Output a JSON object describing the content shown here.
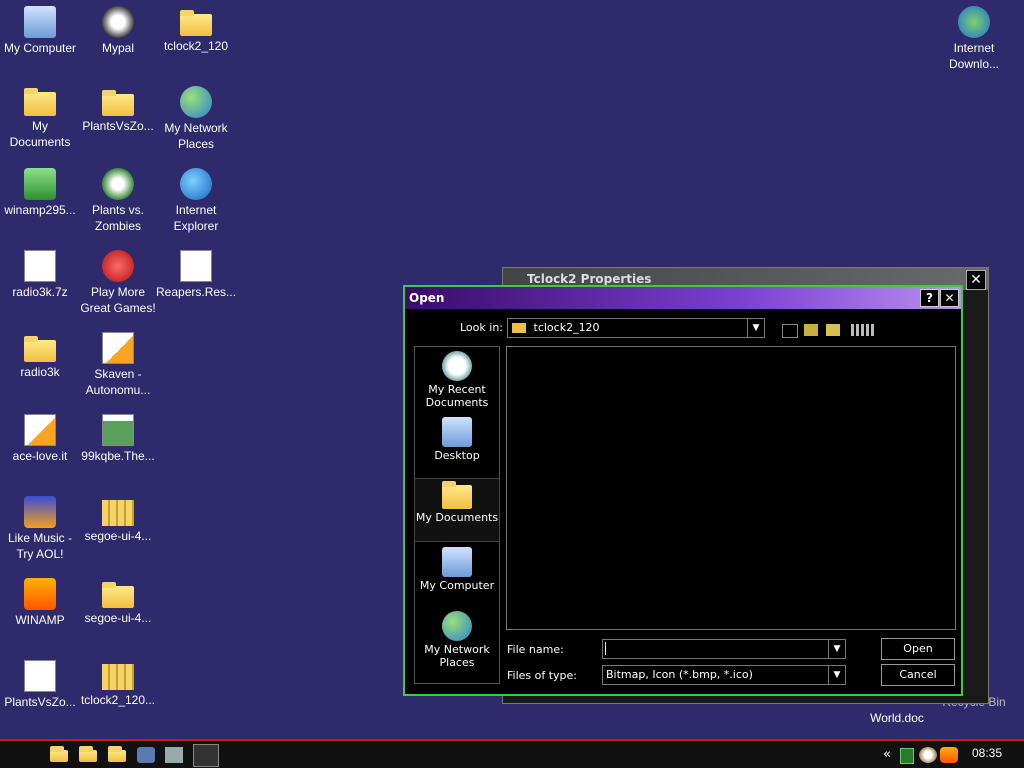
{
  "desktop_icons": [
    {
      "label": "My Computer"
    },
    {
      "label": "Mypal"
    },
    {
      "label": "tclock2_120"
    },
    {
      "label": "Internet Downlo..."
    },
    {
      "label": "My Documents"
    },
    {
      "label": "PlantsVsZo..."
    },
    {
      "label": "My Network Places"
    },
    {
      "label": "winamp295..."
    },
    {
      "label": "Plants vs. Zombies"
    },
    {
      "label": "Internet Explorer"
    },
    {
      "label": "radio3k.7z"
    },
    {
      "label": "Play More Great Games!"
    },
    {
      "label": "Reapers.Res..."
    },
    {
      "label": "radio3k"
    },
    {
      "label": "Skaven - Autonomu..."
    },
    {
      "label": "ace-love.it"
    },
    {
      "label": "99kqbe.The..."
    },
    {
      "label": "Like Music - Try AOL!"
    },
    {
      "label": "segoe-ui-4..."
    },
    {
      "label": "WINAMP"
    },
    {
      "label": "segoe-ui-4..."
    },
    {
      "label": "PlantsVsZo..."
    },
    {
      "label": "tclock2_120..."
    },
    {
      "label": "World.doc"
    },
    {
      "label": "Recycle Bin"
    }
  ],
  "background_window": {
    "title": "Tclock2 Properties"
  },
  "dialog": {
    "title": "Open",
    "help_label": "?",
    "close_label": "✕",
    "look_in_label": "Look in:",
    "look_in_value": "tclock2_120",
    "places": [
      {
        "label": "My Recent Documents"
      },
      {
        "label": "Desktop"
      },
      {
        "label": "My Documents"
      },
      {
        "label": "My Computer"
      },
      {
        "label": "My Network Places"
      }
    ],
    "file_name_label": "File name:",
    "file_name_value": "",
    "files_of_type_label": "Files of type:",
    "files_of_type_value": "Bitmap, Icon (*.bmp, *.ico)",
    "open_label": "Open",
    "cancel_label": "Cancel"
  },
  "taskbar": {
    "tray_chevron": "«",
    "clock": "08:35"
  },
  "colors": {
    "desktop": "#2e2a6b",
    "dialog_border": "#3ecb3e",
    "taskbar_accent": "#c21d1d"
  }
}
